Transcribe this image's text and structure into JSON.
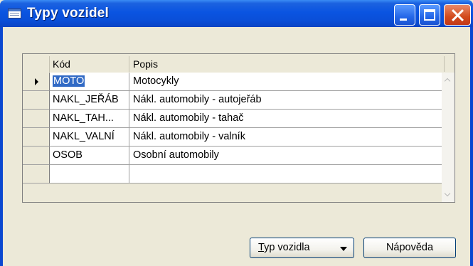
{
  "window": {
    "title": "Typy vozidel",
    "icon": "table-window-icon"
  },
  "grid": {
    "columns": [
      "Kód",
      "Popis"
    ],
    "rows": [
      {
        "kod": "MOTO",
        "popis": "Motocykly",
        "current": true
      },
      {
        "kod": "NAKL_JEŘÁB",
        "popis": "Nákl. automobily - autojeřáb"
      },
      {
        "kod": "NAKL_TAH...",
        "popis": "Nákl. automobily - tahač"
      },
      {
        "kod": "NAKL_VALNÍ",
        "popis": "Nákl. automobily - valník"
      },
      {
        "kod": "OSOB",
        "popis": "Osobní automobily"
      },
      {
        "kod": "",
        "popis": ""
      }
    ]
  },
  "buttons": {
    "type_first_letter": "T",
    "type_rest": "yp vozidla",
    "help": "Nápověda"
  },
  "colors": {
    "titlebar": "#0A54E1",
    "selection": "#316AC5",
    "window_bg": "#ECE9D8"
  }
}
